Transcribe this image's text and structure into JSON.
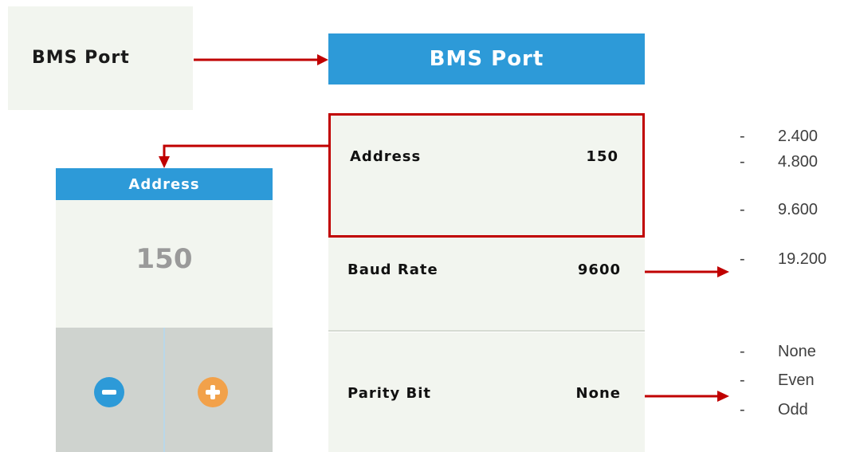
{
  "entry": {
    "label": "BMS Port"
  },
  "panel": {
    "title": "BMS Port",
    "rows": [
      {
        "name": "Address",
        "value": "150"
      },
      {
        "name": "Baud Rate",
        "value": "9600"
      },
      {
        "name": "Parity Bit",
        "value": "None"
      }
    ]
  },
  "editor": {
    "title": "Address",
    "value": "150"
  },
  "baud_options": [
    "2.400",
    "4.800",
    "9.600",
    "19.200"
  ],
  "parity_options": [
    "None",
    "Even",
    "Odd"
  ],
  "colors": {
    "accent": "#2d9ad8",
    "highlight": "#c00000",
    "plus": "#f2a14a"
  }
}
